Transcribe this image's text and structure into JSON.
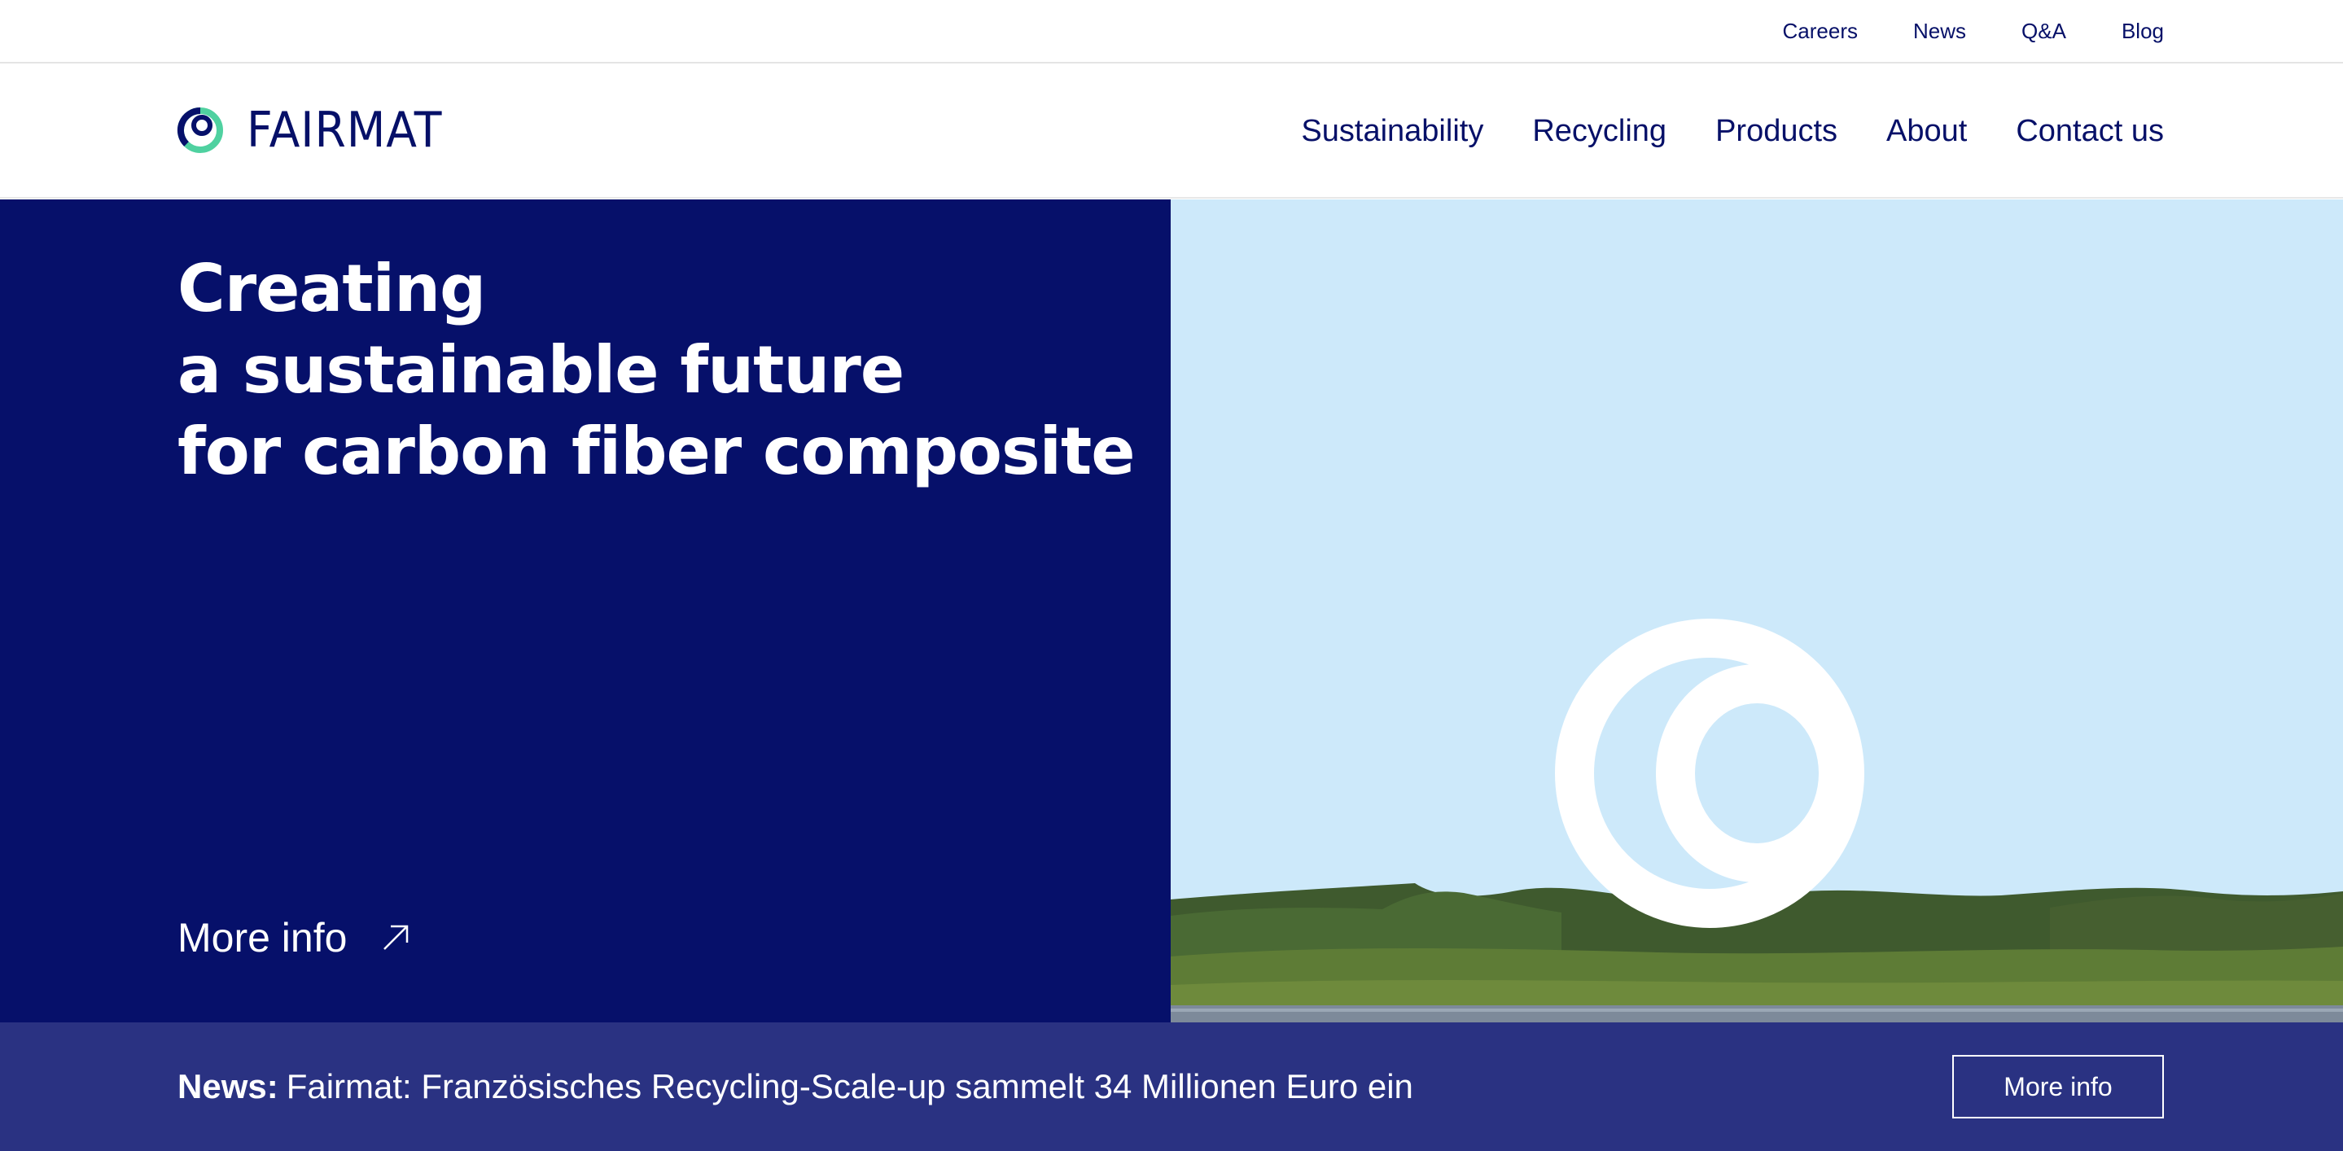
{
  "utility_nav": {
    "items": [
      {
        "label": "Careers"
      },
      {
        "label": "News"
      },
      {
        "label": "Q&A"
      },
      {
        "label": "Blog"
      }
    ]
  },
  "header": {
    "logo_text": "FAIRMAT",
    "nav": [
      {
        "label": "Sustainability"
      },
      {
        "label": "Recycling"
      },
      {
        "label": "Products"
      },
      {
        "label": "About"
      },
      {
        "label": "Contact us"
      }
    ]
  },
  "hero": {
    "title_lines": [
      "Creating",
      "a sustainable future",
      "for carbon fiber composite"
    ],
    "cta_label": "More info",
    "cta_icon": "arrow-up-right-icon"
  },
  "news": {
    "label": "News:",
    "text": "Fairmat: Französisches Recycling-Scale-up sammelt 34 Millionen Euro ein",
    "button_label": "More info"
  },
  "colors": {
    "brand_navy": "#06106a",
    "brand_green": "#4fd1a0",
    "news_bar": "#2a3282",
    "sky": "#cde9fa"
  }
}
